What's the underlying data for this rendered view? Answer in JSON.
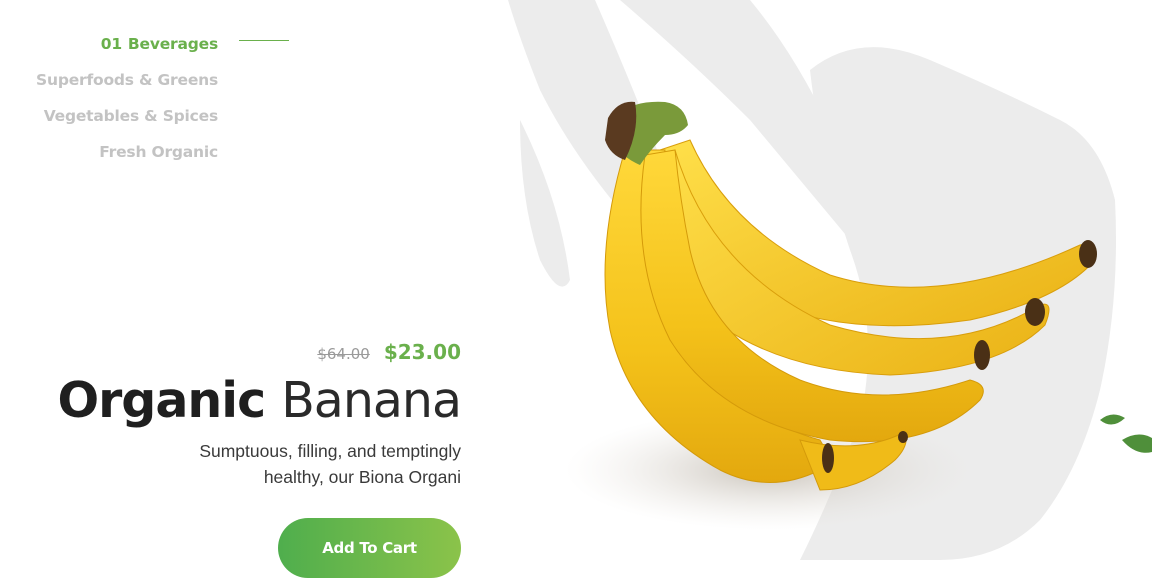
{
  "categories": [
    {
      "number": "01",
      "label": "Beverages",
      "active": true
    },
    {
      "number": "",
      "label": "Superfoods & Greens",
      "active": false
    },
    {
      "number": "",
      "label": "Vegetables & Spices",
      "active": false
    },
    {
      "number": "",
      "label": "Fresh Organic",
      "active": false
    }
  ],
  "product": {
    "old_price": "$64.00",
    "new_price": "$23.00",
    "title_bold": "Organic",
    "title_light": "Banana",
    "description": "Sumptuous, filling, and temptingly healthy, our Biona Organi",
    "cta_label": "Add To Cart"
  },
  "colors": {
    "accent": "#6ab04c",
    "muted_nav": "#c3c3c3",
    "banana": "#f5c518"
  },
  "hero_image": "banana-bunch-image"
}
